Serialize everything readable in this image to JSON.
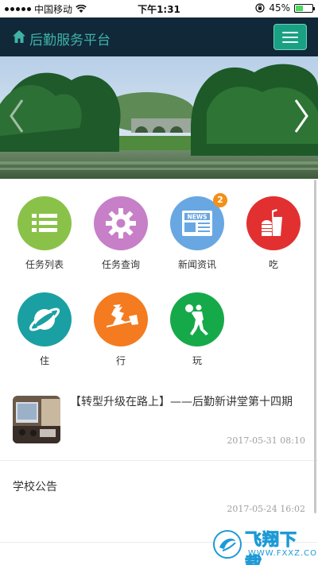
{
  "status_bar": {
    "carrier": "中国移动",
    "time": "下午1:31",
    "battery_percent": "45%",
    "battery_level": 0.45,
    "wifi_icon": "wifi-icon",
    "lock_icon": "orientation-lock-icon"
  },
  "header": {
    "title": "后勤服务平台",
    "home_icon": "home-icon",
    "menu_icon": "hamburger-menu-icon"
  },
  "banner": {
    "prev_icon": "chevron-left-icon",
    "next_icon": "chevron-right-icon"
  },
  "menu": {
    "items": [
      {
        "label": "任务列表",
        "icon": "list-icon",
        "color": "#8ac249"
      },
      {
        "label": "任务查询",
        "icon": "gear-icon",
        "color": "#c77fc8"
      },
      {
        "label": "新闻资讯",
        "icon": "news-icon",
        "color": "#69a7e2",
        "badge": "2"
      },
      {
        "label": "吃",
        "icon": "drink-food-icon",
        "color": "#e23030"
      },
      {
        "label": "住",
        "icon": "planet-icon",
        "color": "#1aa0a3"
      },
      {
        "label": "行",
        "icon": "witch-broom-icon",
        "color": "#f47b20"
      },
      {
        "label": "玩",
        "icon": "basketball-player-icon",
        "color": "#16a94a"
      }
    ]
  },
  "news": [
    {
      "title": "【转型升级在路上】——后勤新讲堂第十四期",
      "date": "2017-05-31 08:10"
    },
    {
      "title": "学校公告",
      "date": "2017-05-24 16:02"
    }
  ],
  "watermark": {
    "text": "飞翔下载",
    "url": "WWW.FXXZ.COM"
  },
  "colors": {
    "header_bg": "#102838",
    "accent": "#1aa184",
    "badge": "#f39019"
  }
}
